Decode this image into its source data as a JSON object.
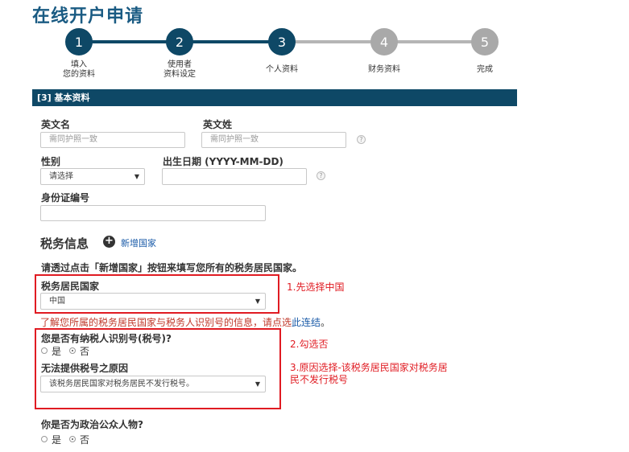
{
  "page": {
    "title": "在线开户申请"
  },
  "steps": [
    {
      "number": "1",
      "label_line1": "填入",
      "label_line2": "您的资料",
      "state": "done"
    },
    {
      "number": "2",
      "label_line1": "使用者",
      "label_line2": "资料设定",
      "state": "done"
    },
    {
      "number": "3",
      "label_line1": "个人资料",
      "label_line2": "",
      "state": "current"
    },
    {
      "number": "4",
      "label_line1": "财务资料",
      "label_line2": "",
      "state": "todo"
    },
    {
      "number": "5",
      "label_line1": "完成",
      "label_line2": "",
      "state": "todo"
    }
  ],
  "section": {
    "header": "[3] 基本资料"
  },
  "form": {
    "first_name": {
      "label": "英文名",
      "placeholder": "需同护照一致",
      "value": ""
    },
    "last_name": {
      "label": "英文姓",
      "placeholder": "需同护照一致",
      "value": ""
    },
    "gender": {
      "label": "性别",
      "selected": "请选择"
    },
    "dob": {
      "label": "出生日期 (YYYY-MM-DD)",
      "value": ""
    },
    "id_number": {
      "label": "身份证编号",
      "value": ""
    },
    "help_glyph": "?"
  },
  "tax": {
    "heading": "税务信息",
    "add_country_label": "新增国家",
    "instruction": "请透过点击「新增国家」按钮来填写您所有的税务居民国家。",
    "residence_label": "税务居民国家",
    "residence_selected": "中国",
    "info_text": "了解您所属的税务居民国家与税务人识别号的信息，请点选",
    "info_link": "此连结",
    "info_end": "。",
    "has_tin_question": "您是否有纳税人识别号(税号)?",
    "yes": "是",
    "no": "否",
    "no_tin_reason_label": "无法提供税号之原因",
    "no_tin_reason_selected": "该税务居民国家对税务居民不发行税号。"
  },
  "pep": {
    "question": "你是否为政治公众人物?",
    "yes": "是",
    "no": "否"
  },
  "annotations": {
    "note1": "1.先选择中国",
    "note2": "2.勾选否",
    "note3_line1": "3.原因选择-该税务居民国家对税务居",
    "note3_line2": "民不发行税号"
  },
  "colors": {
    "primary": "#0e4866",
    "title": "#1a5b83",
    "annotation": "#e01b22",
    "info_text": "#c0392b",
    "link": "#1a5ba8",
    "inactive_step": "#a9a9a9"
  }
}
